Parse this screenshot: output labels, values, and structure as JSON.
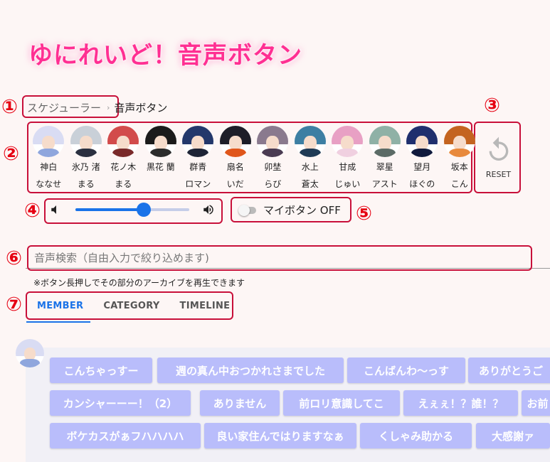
{
  "title": "ゆにれいど！音声ボタン",
  "markers": [
    "①",
    "②",
    "③",
    "④",
    "⑤",
    "⑥",
    "⑦"
  ],
  "breadcrumb": {
    "link": "スケジューラー",
    "separator": "›",
    "current": "音声ボタン"
  },
  "members": [
    {
      "name": "神白",
      "name2": "ななせ",
      "hair": "#d9dcf3",
      "outfit": "#8fa6dd"
    },
    {
      "name": "氷乃 渚",
      "name2": "まる",
      "hair": "#c9d0d8",
      "outfit": "#2b3040"
    },
    {
      "name": "花ノ木",
      "name2": "まる",
      "hair": "#d24b4b",
      "outfit": "#7a2a2a"
    },
    {
      "name": "黒花 蘭",
      "name2": "",
      "hair": "#1b1b1b",
      "outfit": "#2c2c2c"
    },
    {
      "name": "群青",
      "name2": "ロマン",
      "hair": "#23386b",
      "outfit": "#1e2436"
    },
    {
      "name": "扇名",
      "name2": "いだ",
      "hair": "#1e1e28",
      "outfit": "#e0561b"
    },
    {
      "name": "卯埜",
      "name2": "らび",
      "hair": "#8a7a8e",
      "outfit": "#4a3b52"
    },
    {
      "name": "水上",
      "name2": "蒼太",
      "hair": "#3d7fa3",
      "outfit": "#1f3a55"
    },
    {
      "name": "甘成",
      "name2": "じゅい",
      "hair": "#e8a0c4",
      "outfit": "#f0d0e0"
    },
    {
      "name": "翠星",
      "name2": "アスト",
      "hair": "#8fb1a6",
      "outfit": "#5c6b66"
    },
    {
      "name": "望月",
      "name2": "ほぐの",
      "hair": "#1f2f6e",
      "outfit": "#101a3d"
    },
    {
      "name": "坂本",
      "name2": "こん",
      "hair": "#c46420",
      "outfit": "#e88a3d"
    }
  ],
  "reset": {
    "label": "RESET"
  },
  "volume": {
    "value": 0.6
  },
  "toggle": {
    "label": "マイボタン OFF",
    "on": false
  },
  "search": {
    "placeholder": "音声検索（自由入力で絞り込めます)"
  },
  "note": "※ボタン長押しでその部分のアーカイブを再生できます",
  "tabs": [
    {
      "label": "MEMBER",
      "active": true
    },
    {
      "label": "CATEGORY",
      "active": false
    },
    {
      "label": "TIMELINE",
      "active": false
    }
  ],
  "voice_buttons": [
    [
      "こんちゃっすー",
      "週の真ん中おつかれさまでした",
      "こんばんわ〜っす",
      "ありがとうご"
    ],
    [
      "カンシャーーー！（2）",
      "ありません",
      "前ロリ意識してこ",
      "えぇぇ！？誰！？",
      "お前"
    ],
    [
      "ボケカスがぁフハハハハ",
      "良い家住んではりますなぁ",
      "くしゃみ助かる",
      "大感謝ァ"
    ]
  ],
  "colors": {
    "accent": "#1a73e8",
    "title": "#ff2f92",
    "marker": "#e60012",
    "outline": "#c8103a",
    "voice_button": "#b9bdfb"
  }
}
